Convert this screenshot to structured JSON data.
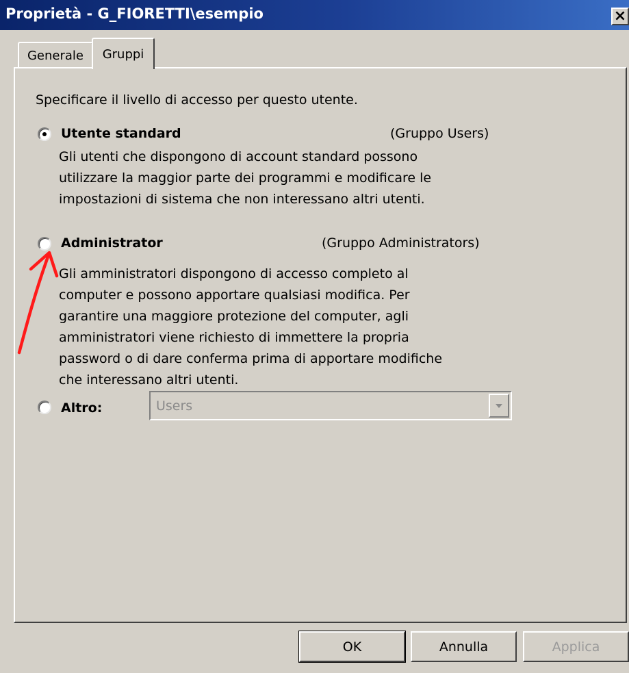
{
  "window": {
    "title": "Proprietà - G_FIORETTI\\esempio",
    "close_label": "×"
  },
  "tabs": [
    {
      "label": "Generale",
      "active": false
    },
    {
      "label": "Gruppi",
      "active": true
    }
  ],
  "panel": {
    "instruction": "Specificare il livello di accesso  per questo utente.",
    "options": [
      {
        "label": "Utente standard",
        "group": "(Gruppo Users)",
        "selected": true,
        "description": [
          "Gli utenti che dispongono di account standard possono",
          "utilizzare la maggior parte dei programmi e modificare le",
          "impostazioni di sistema che non interessano altri utenti."
        ]
      },
      {
        "label": "Administrator",
        "group": "(Gruppo Administrators)",
        "selected": false,
        "description": [
          "Gli amministratori dispongono di accesso completo al",
          "computer e possono apportare qualsiasi modifica. Per",
          "garantire una maggiore protezione del computer, agli",
          "amministratori viene richiesto di immettere la propria",
          "password o di dare conferma prima di apportare modifiche",
          "che interessano altri utenti."
        ]
      },
      {
        "label": "Altro:",
        "selected": false,
        "dropdown_value": "Users",
        "dropdown_enabled": false
      }
    ]
  },
  "buttons": {
    "ok": "OK",
    "cancel": "Annulla",
    "apply": "Applica"
  },
  "colors": {
    "dialog_bg": "#d4d0c8",
    "title_bar": "#0a246a",
    "annotation_arrow": "#ff1a1a",
    "disabled_text": "#9a9a9a"
  }
}
